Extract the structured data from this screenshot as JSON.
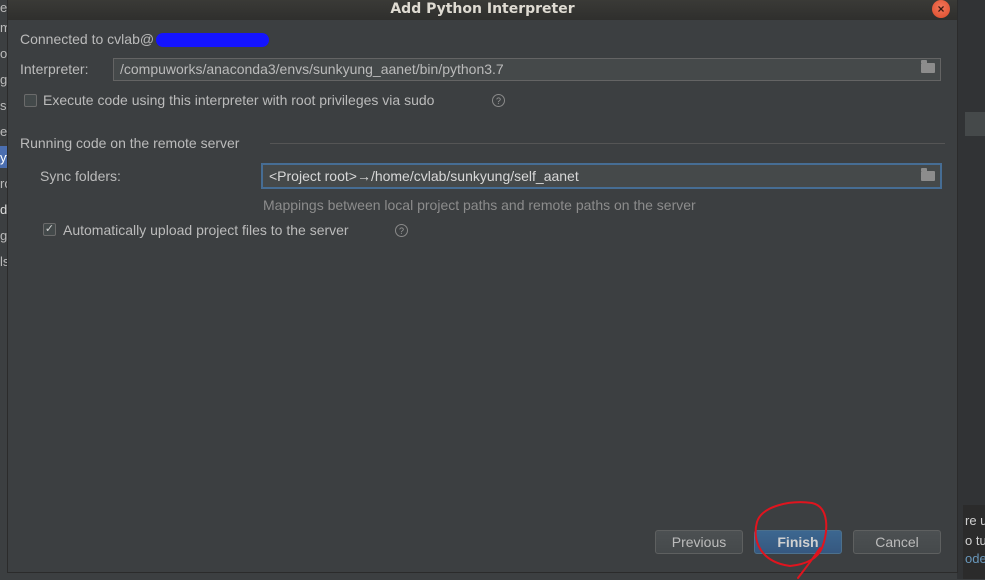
{
  "dialog": {
    "title": "Add Python Interpreter",
    "close_icon": "×",
    "connected_label": "Connected to cvlab@",
    "interpreter_label": "Interpreter:",
    "interpreter_value": "/compuworks/anaconda3/envs/sunkyung_aanet/bin/python3.7",
    "sudo_label": "Execute code using this interpreter with root privileges via sudo",
    "sudo_checked": false,
    "section_title": "Running code on the remote server",
    "sync_label": "Sync folders:",
    "sync_value": "<Project root>→/home/cvlab/sunkyung/self_aanet",
    "sync_hint": "Mappings between local project paths and remote paths on the server",
    "auto_upload_label": "Automatically upload project files to the server",
    "auto_upload_checked": true,
    "help_glyph": "?",
    "check_glyph": "✓",
    "buttons": {
      "previous": "Previous",
      "finish": "Finish",
      "cancel": "Cancel"
    }
  },
  "background": {
    "left_fragments": [
      "e",
      "m",
      "o",
      "gi",
      "si",
      "e",
      "yt",
      "ro",
      "d",
      "gu",
      "ls"
    ],
    "right_fragments": [
      "re u",
      "o tu",
      "ode"
    ]
  },
  "colors": {
    "accent": "#4b6eaf",
    "redaction": "#1414ff",
    "annotation": "#e0141e"
  }
}
